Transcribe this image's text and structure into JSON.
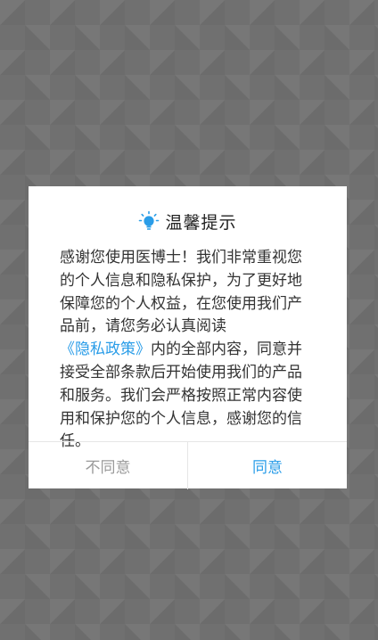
{
  "dialog": {
    "title": "温馨提示",
    "icon": "lightbulb-icon",
    "icon_color": "#2a9de8",
    "message_before": "感谢您使用医博士！我们非常重视您的个人信息和隐私保护，为了更好地保障您的个人权益，在您使用我们产品前，请您务必认真阅读",
    "policy_link": "《隐私政策》",
    "message_after": "内的全部内容，同意并接受全部条款后开始使用我们的产品和服务。我们会严格按照正常内容使用和保护您的个人信息，感谢您的信任。",
    "disagree_label": "不同意",
    "agree_label": "同意"
  },
  "colors": {
    "accent": "#2a9de8",
    "disabled_text": "#9a9a9a",
    "overlay": "#707070"
  }
}
